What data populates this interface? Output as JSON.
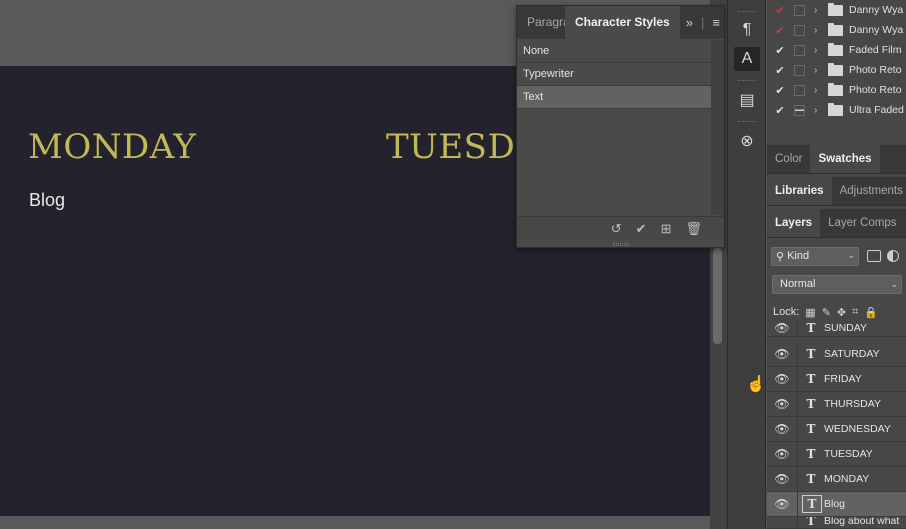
{
  "document": {
    "headings": [
      "MONDAY",
      "TUESD"
    ],
    "body_text": "Blog"
  },
  "character_styles_panel": {
    "tabs": [
      "Paragra",
      "Character Styles"
    ],
    "items": [
      "None",
      "Typewriter",
      "Text"
    ],
    "selected_item": "Text"
  },
  "history": {
    "rows": [
      {
        "label": "Danny Wya",
        "check": "✔",
        "check_color": "red"
      },
      {
        "label": "Danny Wya",
        "check": "✔",
        "check_color": "red"
      },
      {
        "label": "Faded Film",
        "check": "✔",
        "check_color": "white"
      },
      {
        "label": "Photo Reto",
        "check": "✔",
        "check_color": "white"
      },
      {
        "label": "Photo Reto",
        "check": "✔",
        "check_color": "white"
      },
      {
        "label": "Ultra Faded",
        "check": "✔",
        "check_color": "white"
      }
    ]
  },
  "right_tabs": {
    "color_group": [
      "Color",
      "Swatches"
    ],
    "libraries_group": [
      "Libraries",
      "Adjustments"
    ],
    "layers_group": [
      "Layers",
      "Layer Comps"
    ]
  },
  "layers_panel": {
    "kind_filter": "Kind",
    "blend_mode": "Normal",
    "lock_label": "Lock:",
    "layers": [
      "SUNDAY",
      "SATURDAY",
      "FRIDAY",
      "THURSDAY",
      "WEDNESDAY",
      "TUESDAY",
      "MONDAY",
      "Blog",
      "Blog about what"
    ],
    "selected_layer": "Blog"
  },
  "colors": {
    "document_bg": "#24222c",
    "heading_yellow": "#c2b855",
    "panel_bg": "#474747",
    "selected_row": "#626262",
    "history_red_check": "#d23c3c"
  }
}
